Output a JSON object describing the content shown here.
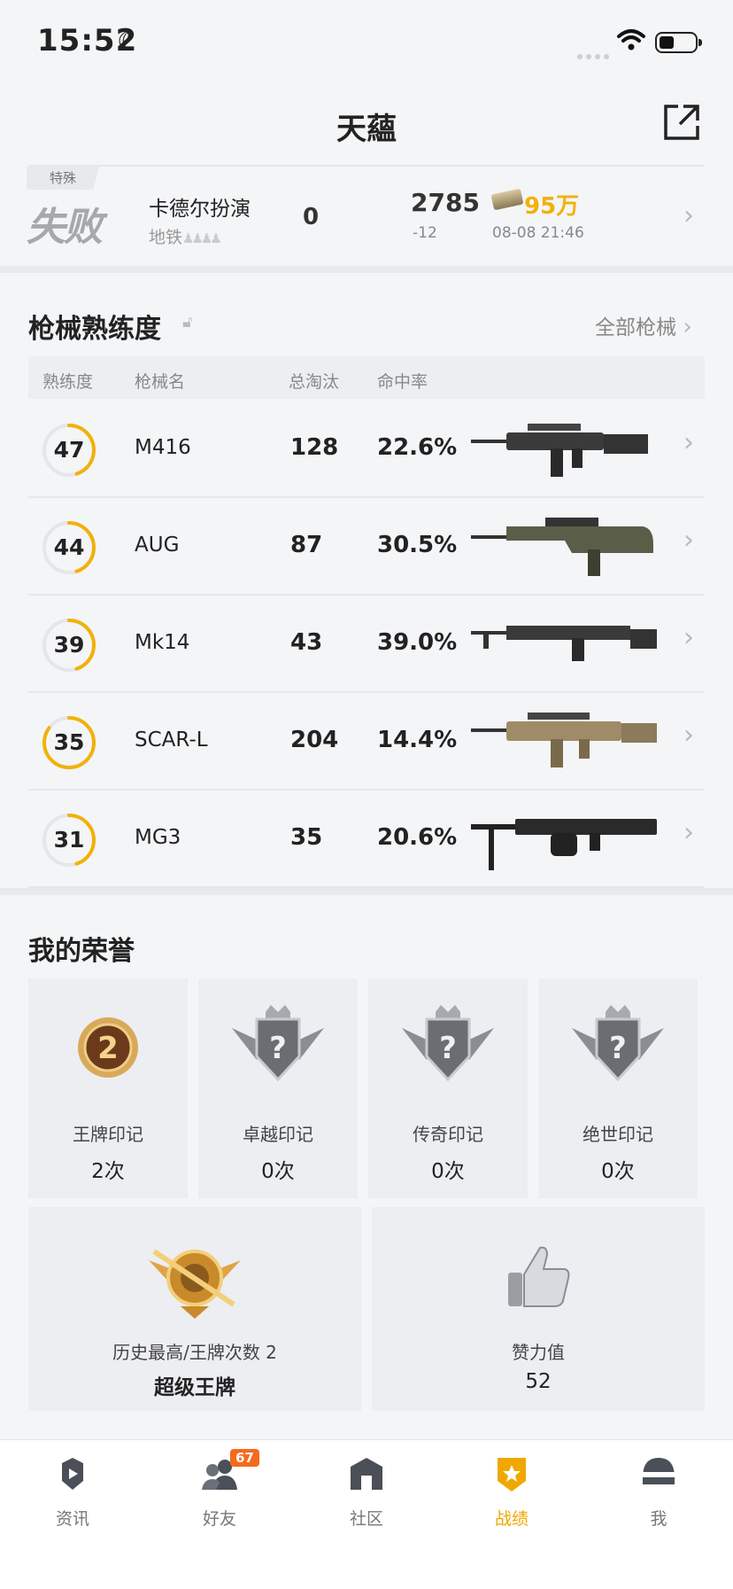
{
  "status": {
    "time": "15:52"
  },
  "header": {
    "title": "天蘊"
  },
  "recent_match": {
    "mode_tag": "特殊",
    "result": "失败",
    "map_name": "卡德尔扮演",
    "map_sub": "地铁",
    "kills": "0",
    "score": "2785",
    "score_delta": "-12",
    "reward": "95万",
    "datetime": "08-08 21:46"
  },
  "weapons": {
    "title": "枪械熟练度",
    "view_all": "全部枪械",
    "headers": {
      "level": "熟练度",
      "name": "枪械名",
      "kills": "总淘汰",
      "accuracy": "命中率"
    },
    "rows": [
      {
        "level": "47",
        "progress": 0.45,
        "name": "M416",
        "kills": "128",
        "accuracy": "22.6%"
      },
      {
        "level": "44",
        "progress": 0.45,
        "name": "AUG",
        "kills": "87",
        "accuracy": "30.5%"
      },
      {
        "level": "39",
        "progress": 0.45,
        "name": "Mk14",
        "kills": "43",
        "accuracy": "39.0%"
      },
      {
        "level": "35",
        "progress": 0.85,
        "name": "SCAR-L",
        "kills": "204",
        "accuracy": "14.4%"
      },
      {
        "level": "31",
        "progress": 0.45,
        "name": "MG3",
        "kills": "35",
        "accuracy": "20.6%"
      }
    ]
  },
  "honors": {
    "title": "我的荣誉",
    "marks": [
      {
        "label": "王牌印记",
        "value": "2次",
        "icon": "ace-mark-medal-icon",
        "num": "2"
      },
      {
        "label": "卓越印记",
        "value": "0次",
        "icon": "excellence-mark-medal-icon",
        "num": "?"
      },
      {
        "label": "传奇印记",
        "value": "0次",
        "icon": "legend-mark-medal-icon",
        "num": "?"
      },
      {
        "label": "绝世印记",
        "value": "0次",
        "icon": "peerless-mark-medal-icon",
        "num": "?"
      }
    ],
    "highest": {
      "label": "历史最高/王牌次数 2",
      "value": "超级王牌"
    },
    "likes": {
      "label": "赞力值",
      "value": "52"
    }
  },
  "tabbar": {
    "items": [
      {
        "label": "资讯"
      },
      {
        "label": "好友",
        "badge": "67"
      },
      {
        "label": "社区"
      },
      {
        "label": "战绩"
      },
      {
        "label": "我"
      }
    ]
  },
  "colors": {
    "accent": "#f0a800",
    "gold": "#f2b10a",
    "badge": "#f46a1e"
  }
}
